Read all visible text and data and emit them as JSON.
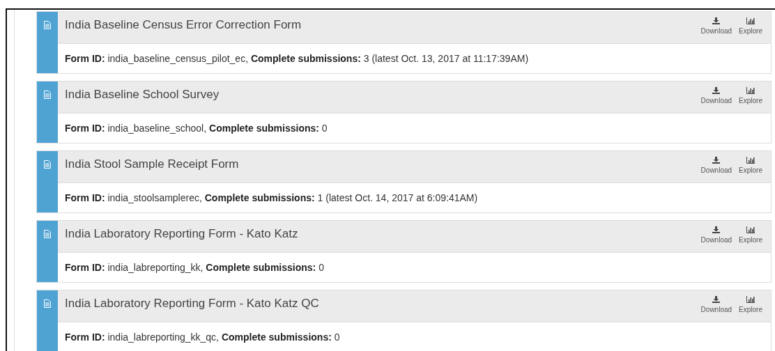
{
  "forms": [
    {
      "title": "India Baseline Census Error Correction Form",
      "details": "**Form ID:** india_baseline_census_pilot_ec, **Complete submissions:** 3 (latest Oct. 13, 2017 at 11:17:39AM)",
      "actions": [
        "Download",
        "Explore"
      ]
    },
    {
      "title": "India Baseline School Survey",
      "details": "**Form ID:** india_baseline_school, **Complete submissions:** 0",
      "actions": [
        "Download",
        "Explore"
      ]
    },
    {
      "title": "India Stool Sample Receipt Form",
      "details": "**Form ID:** india_stoolsamplerec, **Complete submissions:** 1 (latest Oct. 14, 2017 at 6:09:41AM)",
      "actions": [
        "Download",
        "Explore"
      ]
    },
    {
      "title": "India Laboratory Reporting Form - Kato Katz",
      "details": "**Form ID:** india_labreporting_kk, **Complete submissions:** 0",
      "actions": [
        "Download",
        "Explore"
      ]
    },
    {
      "title": "India Laboratory Reporting Form - Kato Katz QC",
      "details": "**Form ID:** india_labreporting_kk_qc, **Complete submissions:** 0",
      "actions": [
        "Download",
        "Explore"
      ]
    }
  ]
}
